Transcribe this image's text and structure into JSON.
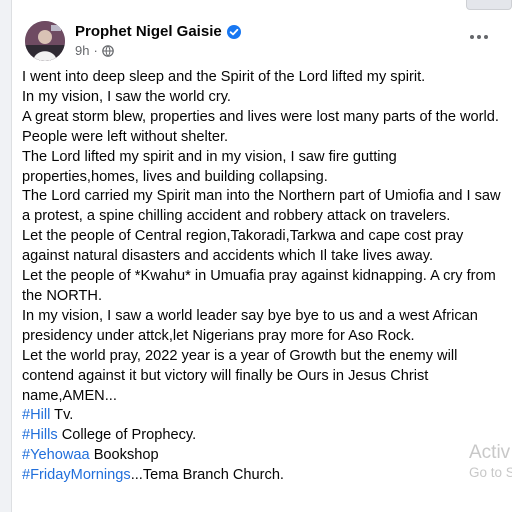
{
  "post": {
    "author": "Prophet Nigel Gaisie",
    "time": "9h",
    "meta_separator": "·",
    "paragraphs": [
      "I went into deep sleep and the Spirit of the Lord lifted my spirit.",
      "In my vision, I saw the world cry.",
      "A great storm blew, properties and lives were lost many parts of the world.",
      "People were left without shelter.",
      "The Lord lifted my spirit and in my vision, I saw fire gutting properties,homes, lives and building collapsing.",
      "The Lord carried my Spirit man into the Northern part of Umiofia and I saw a protest, a spine chilling accident and robbery attack on travelers.",
      "Let the people of Central region,Takoradi,Tarkwa and cape cost pray against natural disasters and accidents which Il take lives away.",
      "Let the people of *Kwahu* in Umuafia pray against kidnapping. A cry from the NORTH.",
      "In my vision, I saw a world leader say bye bye to us and a west African presidency under attck,let Nigerians pray more for Aso Rock.",
      "Let the world pray, 2022 year is a year of Growth but the enemy will contend against it  but victory will finally be Ours in Jesus Christ name,AMEN..."
    ],
    "hashtag_lines": [
      {
        "tag": "#Hill",
        "text": " Tv."
      },
      {
        "tag": "#Hills",
        "text": " College of Prophecy."
      },
      {
        "tag": "#Yehowaa",
        "text": " Bookshop"
      },
      {
        "tag": "#FridayMornings",
        "text": "...Tema Branch Church."
      }
    ]
  },
  "watermark": {
    "line1": "Activ",
    "line2": "Go to S"
  },
  "icons": {
    "verified": "verified-badge-icon",
    "audience": "globe-icon",
    "more": "more-options-icon"
  },
  "colors": {
    "hashtag": "#216fdb",
    "verified": "#1877f2",
    "text": "#050505",
    "meta": "#65676b"
  }
}
